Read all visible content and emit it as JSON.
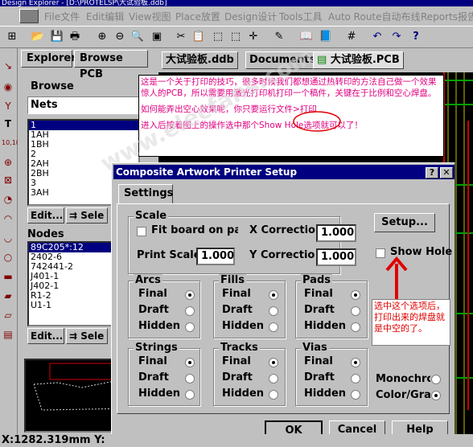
{
  "window": {
    "title": "Design Explorer - [D:\\PROTELSP\\大试验板.ddb]"
  },
  "menu": [
    "File文件",
    "Edit编辑",
    "View视图",
    "Place放置",
    "Design设计",
    "Tools工具",
    "Auto Route自动布线",
    "Reports报告"
  ],
  "explorer": {
    "tabs": [
      "Explorer",
      "Browse PCB"
    ],
    "browse_label": "Browse",
    "browse_select": "Nets",
    "nets": [
      "1",
      "1AH",
      "1BH",
      "2",
      "2AH",
      "2BH",
      "3",
      "3AH"
    ],
    "edit_label": "Edit...",
    "select_label": "Sele",
    "nodes_label": "Nodes",
    "nodes": [
      "89C205*:12",
      "2402-6",
      "742441-2",
      "J401-1",
      "J402-1",
      "R1-2",
      "U1-1"
    ]
  },
  "doc_tabs": [
    "大试验板.ddb",
    "Documents",
    "大试验板.PCB"
  ],
  "annotation": {
    "line1": "这是一个关于打印的技巧，很多时候我们都想通过热转印的方法自己做一个效果惊人的PCB，所以需要用激光打印机打印一个稿件，关键在于比例和空心焊盘。",
    "line2": "如何能弄出空心效果呢，你只要运行文件>打印",
    "line3": "进入后按着图上的操作选中那个Show Hole选项就可以了！",
    "arrow_note": "选中这个选项后，打印出来的焊盘就是中空的了。",
    "watermark": "www.elecfans.com"
  },
  "dialog": {
    "title": "Composite Artwork Printer Setup",
    "help_btn": "?",
    "close_btn": "✕",
    "tab": "Settings",
    "scale": {
      "label": "Scale",
      "fit_board": "Fit board on page",
      "x_correction_label": "X Correction",
      "x_correction": "1.000",
      "print_scale_label": "Print Scale",
      "print_scale": "1.000",
      "y_correction_label": "Y Correction",
      "y_correction": "1.000"
    },
    "setup_btn": "Setup...",
    "show_hole": "Show Hole",
    "groups": [
      {
        "name": "Arcs",
        "selected": "Final"
      },
      {
        "name": "Fills",
        "selected": "Final"
      },
      {
        "name": "Pads",
        "selected": "Final"
      },
      {
        "name": "Strings",
        "selected": "Final"
      },
      {
        "name": "Tracks",
        "selected": "Final"
      },
      {
        "name": "Vias",
        "selected": "Final"
      }
    ],
    "options": [
      "Final",
      "Draft",
      "Hidden"
    ],
    "mono": "Monochrome",
    "color_gray": "Color/Gray",
    "ok": "OK",
    "cancel": "Cancel",
    "help": "Help"
  },
  "status": {
    "coords": "X:1282.319mm Y:"
  },
  "colors": {
    "title_bg": "#000080",
    "annotation": "#e00080",
    "arrow": "#e00000"
  }
}
